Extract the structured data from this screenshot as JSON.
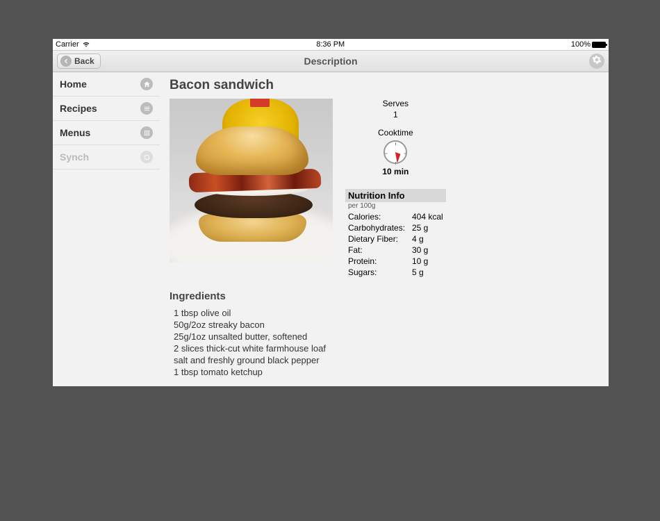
{
  "status": {
    "carrier": "Carrier",
    "time": "8:36 PM",
    "battery": "100%"
  },
  "nav": {
    "back_label": "Back",
    "title": "Description"
  },
  "sidebar": {
    "items": [
      {
        "label": "Home"
      },
      {
        "label": "Recipes"
      },
      {
        "label": "Menus"
      },
      {
        "label": "Synch"
      }
    ]
  },
  "recipe": {
    "title": "Bacon sandwich",
    "serves_label": "Serves",
    "serves_value": "1",
    "cooktime_label": "Cooktime",
    "cooktime_value": "10 min",
    "nutrition": {
      "heading": "Nutrition Info",
      "sub": "per 100g",
      "rows": [
        {
          "k": "Calories:",
          "v": "404 kcal"
        },
        {
          "k": "Carbohydrates:",
          "v": "25 g"
        },
        {
          "k": "Dietary Fiber:",
          "v": "4 g"
        },
        {
          "k": "Fat:",
          "v": "30 g"
        },
        {
          "k": "Protein:",
          "v": "10 g"
        },
        {
          "k": "Sugars:",
          "v": "5 g"
        }
      ]
    },
    "ingredients_heading": "Ingredients",
    "ingredients": [
      "1 tbsp olive oil",
      "50g/2oz streaky bacon",
      "25g/1oz unsalted butter, softened",
      "2 slices thick-cut white farmhouse loaf",
      "salt and freshly ground black pepper",
      "1 tbsp tomato ketchup"
    ]
  }
}
